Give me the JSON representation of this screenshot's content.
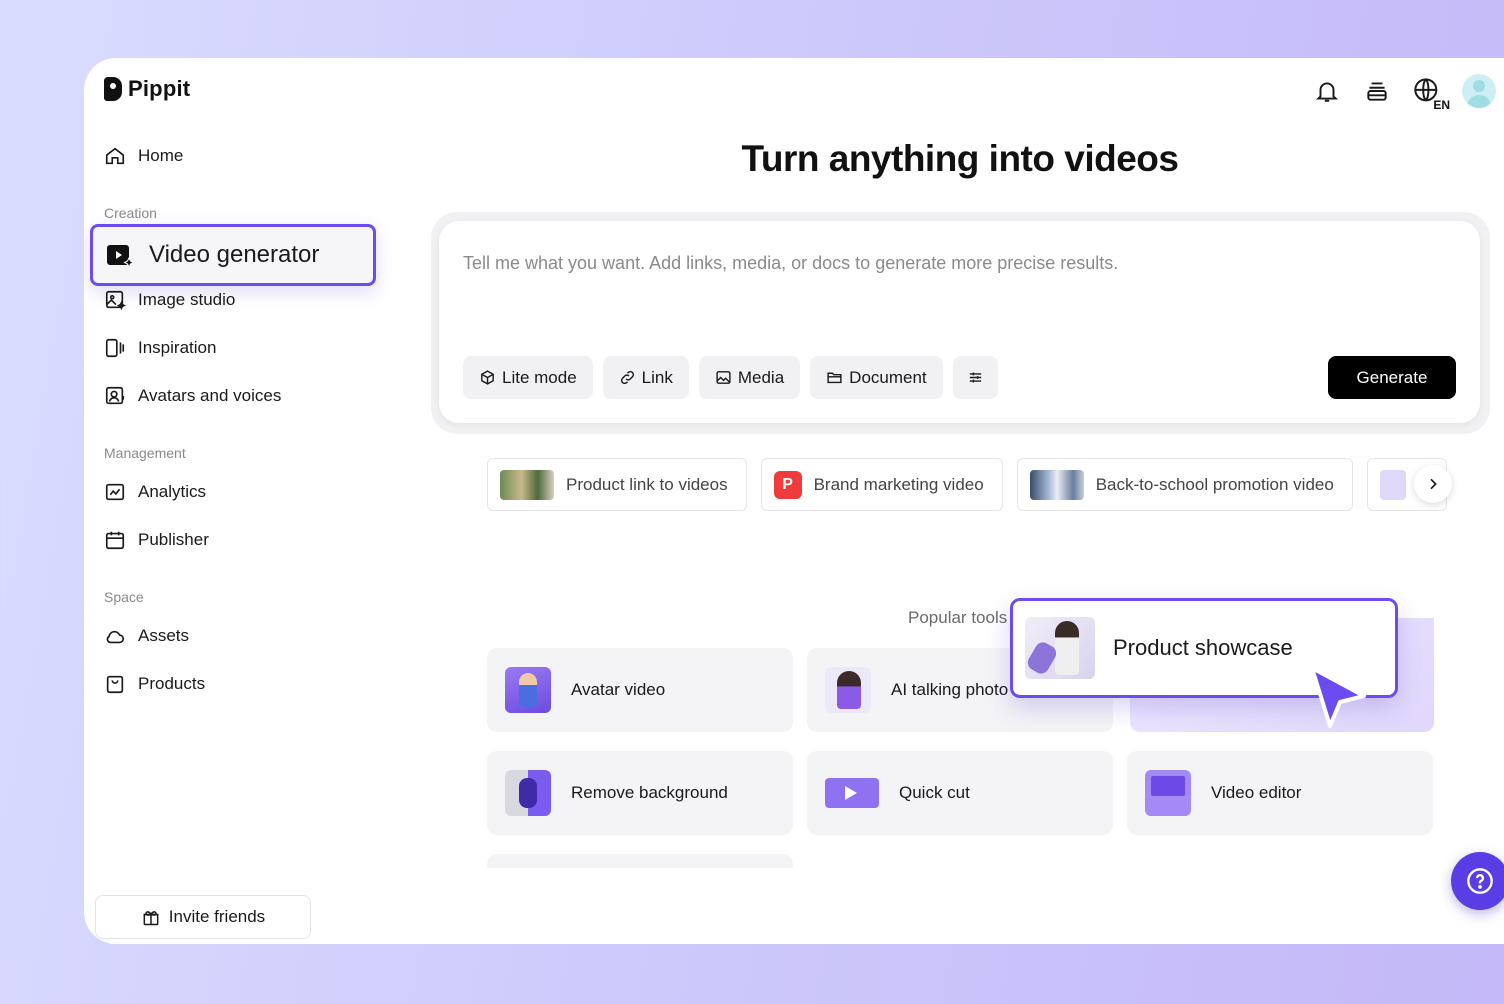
{
  "app": {
    "name": "Pippit"
  },
  "header": {
    "icons": [
      "bell-icon",
      "stack-icon",
      "globe-icon",
      "avatar"
    ],
    "language": "EN"
  },
  "sidebar": {
    "home": "Home",
    "sections": {
      "creation": "Creation",
      "management": "Management",
      "space": "Space"
    },
    "creation_items": [
      "Video generator",
      "Image studio",
      "Inspiration",
      "Avatars and voices"
    ],
    "management_items": [
      "Analytics",
      "Publisher"
    ],
    "space_items": [
      "Assets",
      "Products"
    ],
    "invite": "Invite friends"
  },
  "main": {
    "headline": "Turn anything into videos",
    "prompt_placeholder": "Tell me what you want. Add links, media, or docs to generate more precise results.",
    "chips": [
      "Lite mode",
      "Link",
      "Media",
      "Document"
    ],
    "generate": "Generate",
    "suggestions": [
      "Product link to videos",
      "Brand marketing video",
      "Back-to-school promotion video"
    ],
    "suggestion_badge": "P",
    "popular_label": "Popular tools",
    "tools": [
      "Avatar video",
      "AI talking photo",
      "Remove background",
      "Quick cut",
      "Video editor"
    ],
    "showcase": "Product showcase"
  },
  "colors": {
    "accent": "#6c4cf0",
    "generate_bg": "#000000",
    "help_bg": "#5a3de4",
    "badge_red": "#ef3b3b"
  }
}
